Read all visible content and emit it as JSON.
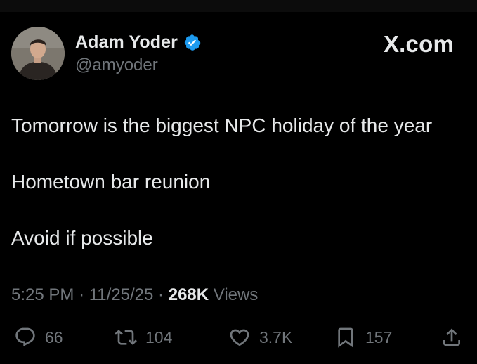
{
  "post": {
    "author": {
      "display_name": "Adam Yoder",
      "handle": "@amyoder",
      "verified": true
    },
    "brand": "X.com",
    "lines": [
      "Tomorrow is the biggest NPC holiday of the year",
      "Hometown bar reunion",
      "Avoid if possible"
    ],
    "meta": {
      "time": "5:25 PM",
      "separator": "·",
      "date": "11/25/25",
      "views_count": "268K",
      "views_label": "Views"
    },
    "actions": {
      "replies": "66",
      "reposts": "104",
      "likes": "3.7K",
      "bookmarks": "157"
    }
  },
  "colors": {
    "background": "#000000",
    "text_primary": "#e7e9ea",
    "text_secondary": "#71767b",
    "verified_badge": "#1d9bf0"
  },
  "icons": [
    "verified-badge-icon",
    "reply-icon",
    "repost-icon",
    "like-icon",
    "bookmark-icon",
    "share-icon"
  ]
}
